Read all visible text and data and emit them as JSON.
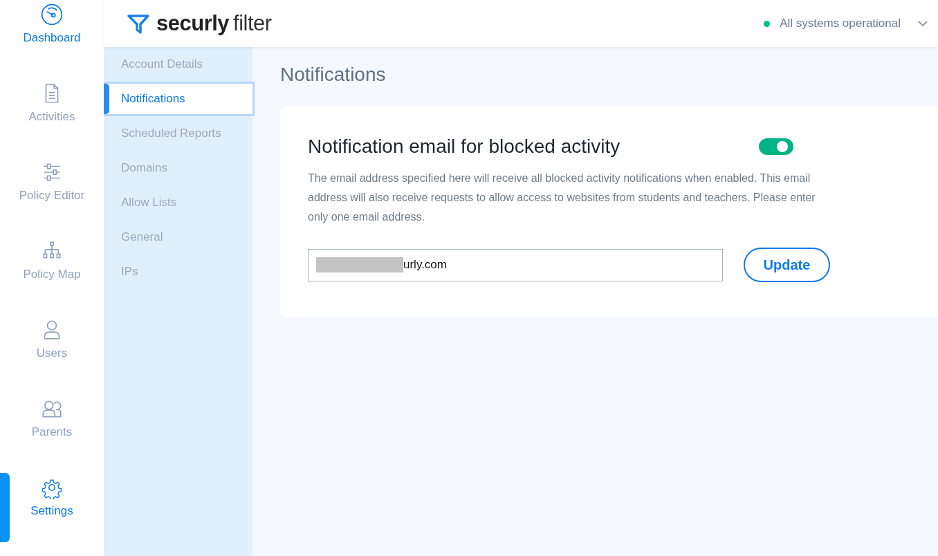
{
  "nav": {
    "items": [
      {
        "label": "Dashboard",
        "kind": "gauge",
        "highlighted": true,
        "selected": false
      },
      {
        "label": "Activities",
        "kind": "document",
        "highlighted": false,
        "selected": false
      },
      {
        "label": "Policy Editor",
        "kind": "sliders",
        "highlighted": false,
        "selected": false
      },
      {
        "label": "Policy Map",
        "kind": "tree",
        "highlighted": false,
        "selected": false
      },
      {
        "label": "Users",
        "kind": "user",
        "highlighted": false,
        "selected": false
      },
      {
        "label": "Parents",
        "kind": "users",
        "highlighted": false,
        "selected": false
      },
      {
        "label": "Settings",
        "kind": "gear",
        "highlighted": true,
        "selected": true
      }
    ]
  },
  "header": {
    "logo_bold": "securly",
    "logo_light": "filter",
    "status": {
      "text": "All systems operational",
      "color": "#00c08b"
    }
  },
  "settings_menu": {
    "items": [
      {
        "label": "Account Details",
        "selected": false
      },
      {
        "label": "Notifications",
        "selected": true
      },
      {
        "label": "Scheduled Reports",
        "selected": false
      },
      {
        "label": "Domains",
        "selected": false
      },
      {
        "label": "Allow Lists",
        "selected": false
      },
      {
        "label": "General",
        "selected": false
      },
      {
        "label": "IPs",
        "selected": false
      }
    ]
  },
  "page": {
    "title": "Notifications",
    "card": {
      "title": "Notification email for blocked activity",
      "on": true,
      "description": "The email address specified here will receive all blocked activity notifications when enabled. This email address will also receive requests to allow access to websites from students and teachers. Please enter only one email address.",
      "email": {
        "value": "urly.com",
        "redacted": true
      },
      "button": "Update"
    }
  }
}
